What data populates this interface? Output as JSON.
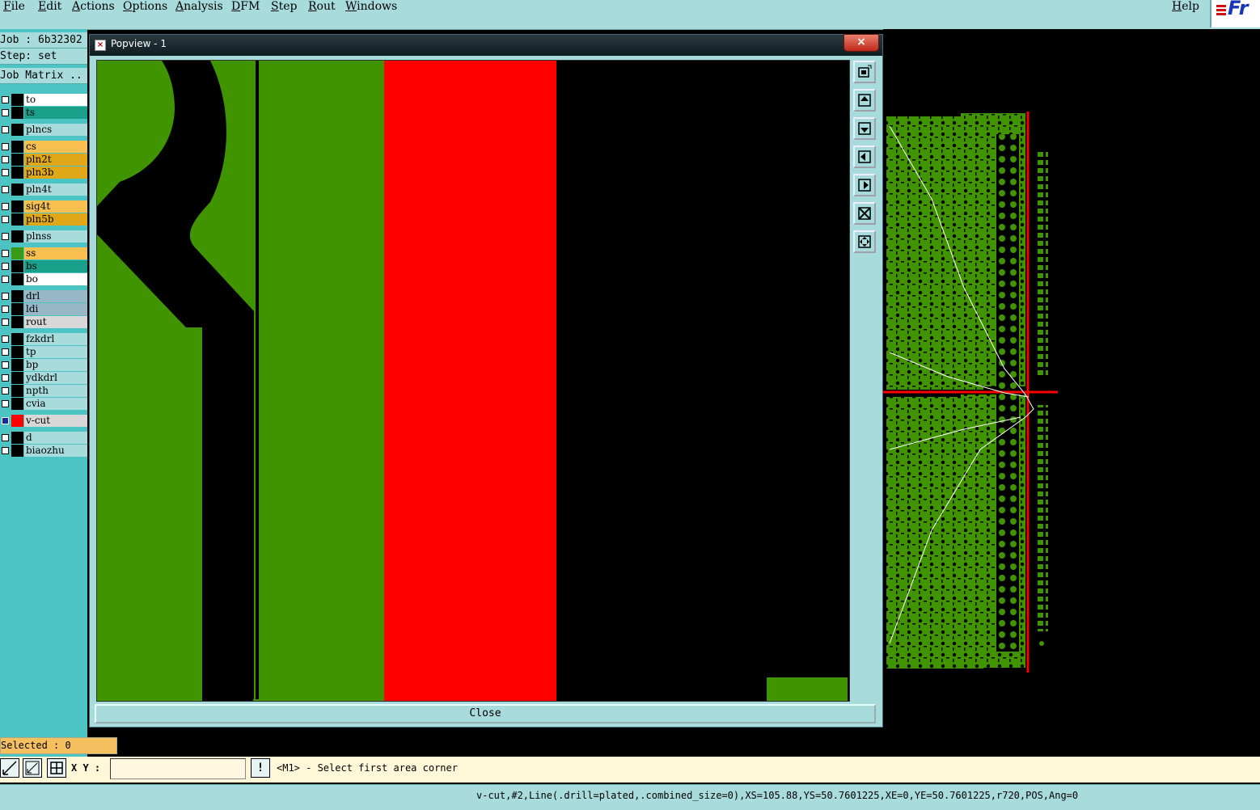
{
  "menubar": {
    "items": [
      "File",
      "Edit",
      "Actions",
      "Options",
      "Analysis",
      "DFM",
      "Step",
      "Rout",
      "Windows"
    ],
    "help": "Help",
    "brand": "Fr"
  },
  "left_panel": {
    "job": "Job : 6b32302",
    "step": "Step: set",
    "matrix": "Job Matrix ..",
    "layers": [
      {
        "name": "to",
        "color": "#ffffff",
        "swatch": "#000000"
      },
      {
        "name": "ts",
        "color": "#1aa08a",
        "swatch": "#000000"
      },
      {
        "name": "plncs",
        "color": "#a8dcdc",
        "swatch": "#000000"
      },
      {
        "name": "cs",
        "color": "#f8c050",
        "swatch": "#000000"
      },
      {
        "name": "pln2t",
        "color": "#e0a818",
        "swatch": "#000000"
      },
      {
        "name": "pln3b",
        "color": "#e0a818",
        "swatch": "#000000"
      },
      {
        "name": "pln4t",
        "color": "#a8dcdc",
        "swatch": "#000000"
      },
      {
        "name": "sig4t",
        "color": "#f8c050",
        "swatch": "#000000"
      },
      {
        "name": "pln5b",
        "color": "#e0a818",
        "swatch": "#000000"
      },
      {
        "name": "plnss",
        "color": "#a8dcdc",
        "swatch": "#000000"
      },
      {
        "name": "ss",
        "color": "#f8c050",
        "swatch": "#3a9a18"
      },
      {
        "name": "bs",
        "color": "#1aa08a",
        "swatch": "#000000"
      },
      {
        "name": "bo",
        "color": "#ffffff",
        "swatch": "#000000"
      },
      {
        "name": "drl",
        "color": "#98b8c8",
        "swatch": "#000000"
      },
      {
        "name": "ldi",
        "color": "#98b8c8",
        "swatch": "#000000"
      },
      {
        "name": "rout",
        "color": "#d8d8d8",
        "swatch": "#000000"
      },
      {
        "name": "fzkdrl",
        "color": "#a8dcdc",
        "swatch": "#000000"
      },
      {
        "name": "tp",
        "color": "#a8dcdc",
        "swatch": "#000000"
      },
      {
        "name": "bp",
        "color": "#a8dcdc",
        "swatch": "#000000"
      },
      {
        "name": "ydkdrl",
        "color": "#a8dcdc",
        "swatch": "#000000"
      },
      {
        "name": "npth",
        "color": "#a8dcdc",
        "swatch": "#000000"
      },
      {
        "name": "cvia",
        "color": "#a8dcdc",
        "swatch": "#000000"
      },
      {
        "name": "v-cut",
        "color": "#d8d8d8",
        "swatch": "#ff0000",
        "active": true
      },
      {
        "name": "d",
        "color": "#a8dcdc",
        "swatch": "#000000"
      },
      {
        "name": "biaozhu",
        "color": "#a8dcdc",
        "swatch": "#000000"
      }
    ]
  },
  "popview": {
    "title": "Popview - 1",
    "close_x": "×",
    "close_label": "Close",
    "tools": [
      "zoom-window-icon",
      "zoom-in-icon",
      "zoom-out-icon",
      "pan-left-icon",
      "pan-right-icon",
      "fit-home-icon",
      "pan-icon"
    ]
  },
  "bottom": {
    "selected": "Selected : 0",
    "xy_label": "X Y :",
    "xy_value": "",
    "excl": "!",
    "prompt": "<M1> - Select first area corner",
    "status": "v-cut,#2,Line(.drill=plated,.combined_size=0),XS=105.88,YS=50.7601225,XE=0,YE=50.7601225,r720,POS,Ang=0"
  },
  "colors": {
    "panel": "#a8dcdc",
    "copper": "#3f9400",
    "vcut": "#ff0000",
    "background": "#000000"
  }
}
